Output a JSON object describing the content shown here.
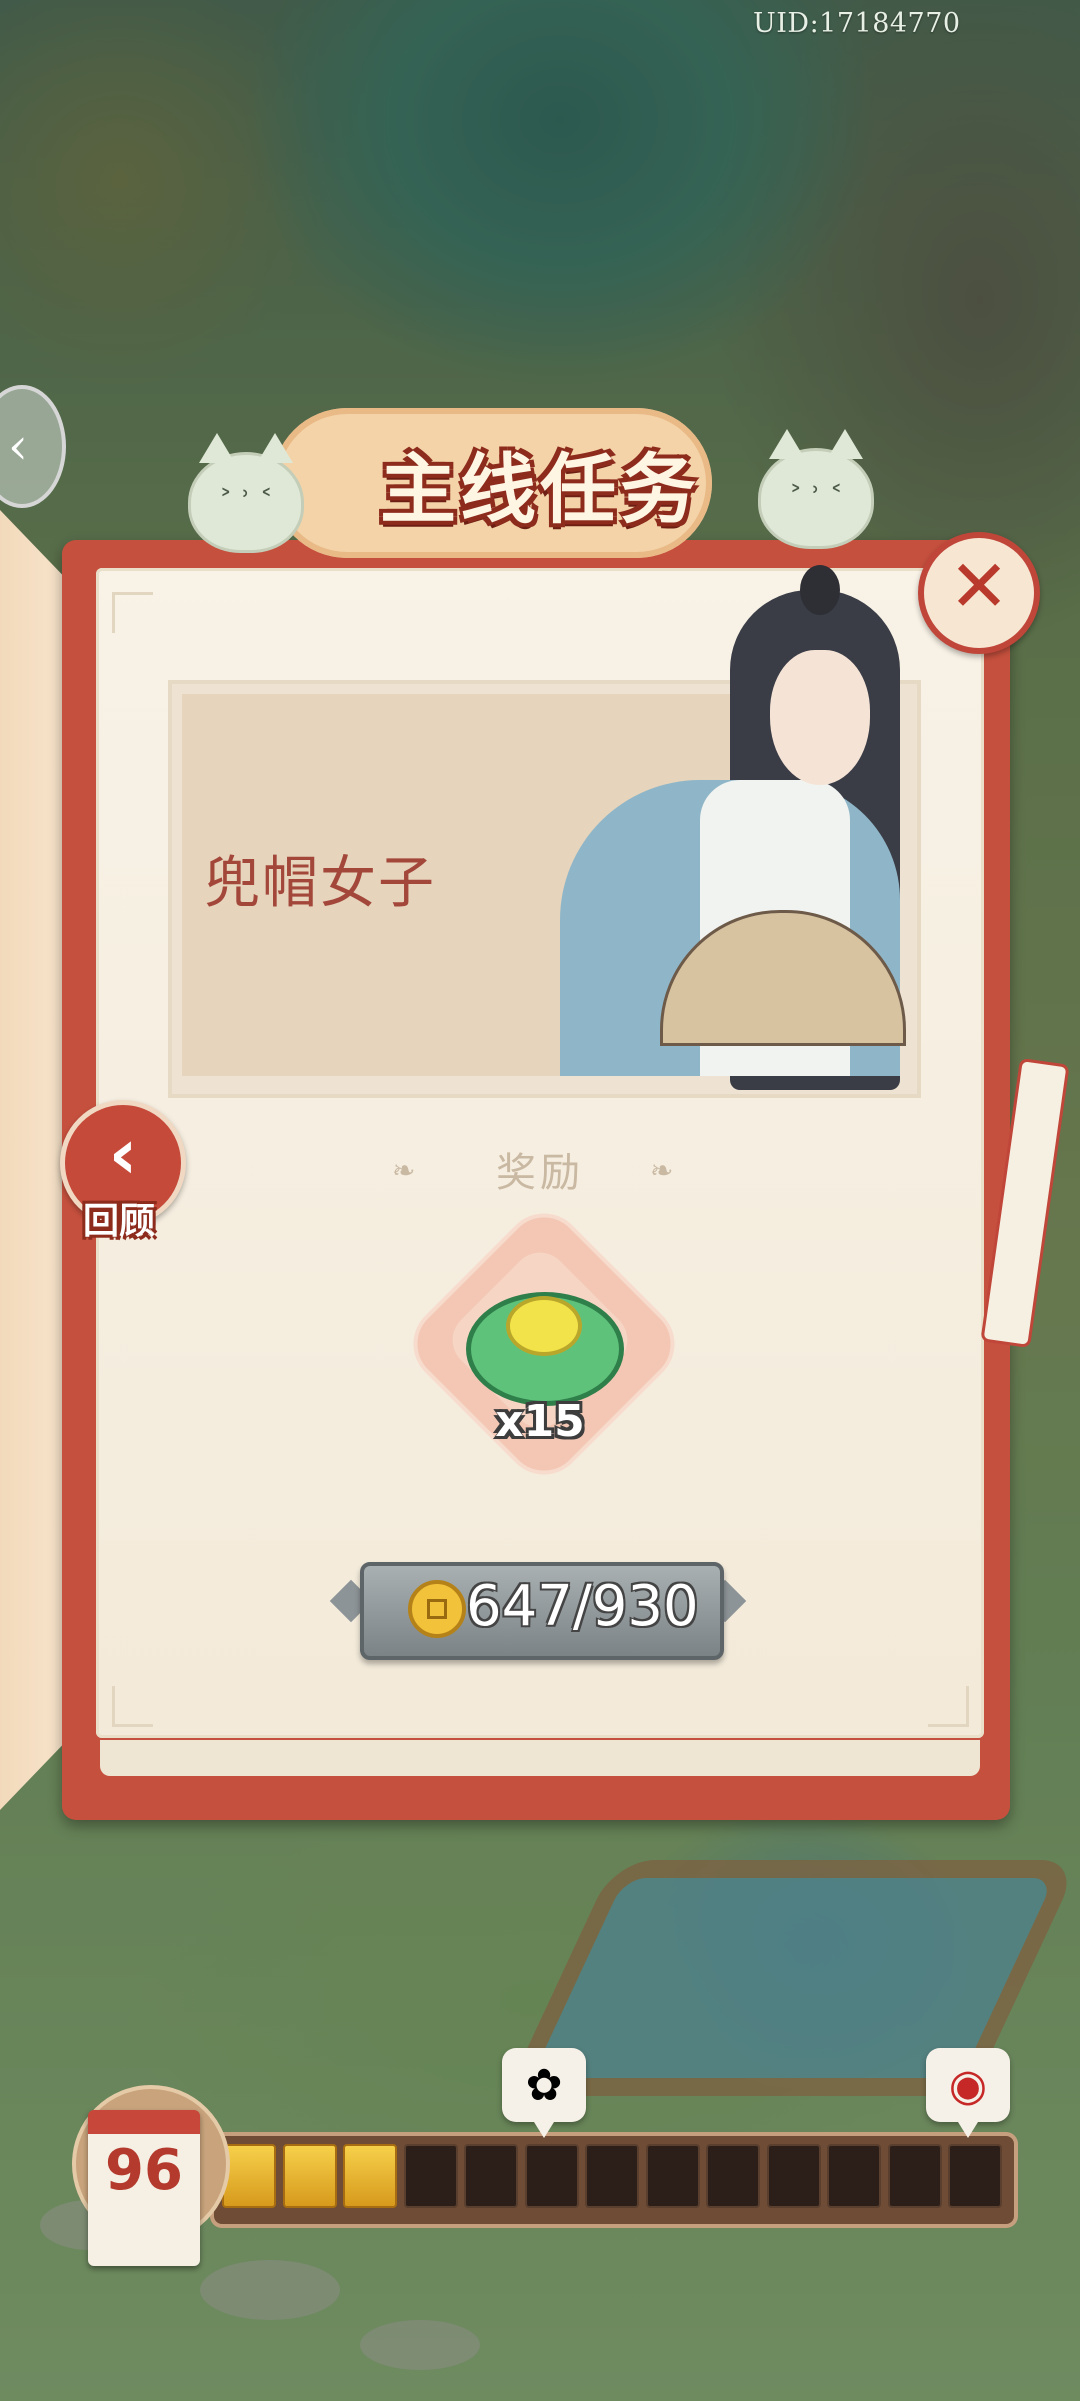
{
  "uid": "UID:17184770",
  "panel": {
    "title": "主线任务",
    "story_title": "兜帽女子",
    "review_label": "回顾",
    "reward_label": "奖励",
    "reward_qty": "x15",
    "cost_text": "647/930"
  },
  "progress": {
    "day": "96",
    "filled_segments": 3,
    "total_segments": 13
  },
  "icons": {
    "close": "close-icon",
    "back": "chevron-left-icon",
    "coin": "copper-coin-icon",
    "reward": "cloud-jade-icon",
    "milestone_1": "cotton-icon",
    "milestone_2": "red-box-icon"
  },
  "colors": {
    "accent": "#c6503e",
    "title_outline": "#8d2b1d",
    "segment_on": "#f6d04a",
    "segment_off": "#2c1e18"
  }
}
